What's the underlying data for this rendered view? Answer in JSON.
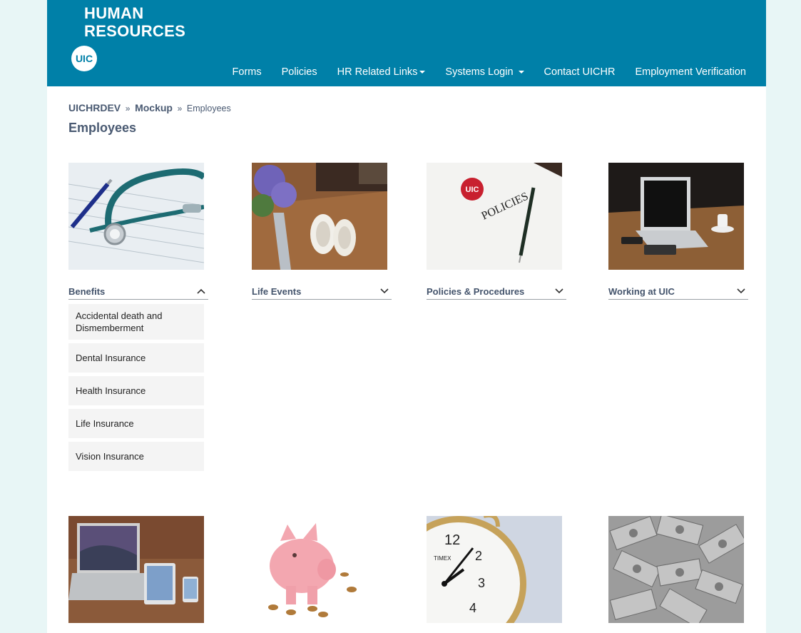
{
  "header": {
    "brand_line1": "HUMAN",
    "brand_line2": "RESOURCES",
    "logo_text": "UIC",
    "nav": [
      {
        "label": "Forms",
        "dropdown": false
      },
      {
        "label": "Policies",
        "dropdown": false
      },
      {
        "label": "HR Related Links",
        "dropdown": true
      },
      {
        "label": "Systems Login",
        "dropdown": true
      },
      {
        "label": "Contact UICHR",
        "dropdown": false
      },
      {
        "label": "Employment Verification",
        "dropdown": false
      }
    ]
  },
  "breadcrumb": {
    "items": [
      "UICHRDEV",
      "Mockup",
      "Employees"
    ],
    "separator": "»"
  },
  "page_title": "Employees",
  "cards": [
    {
      "title": "Benefits",
      "expanded": true,
      "image": "stethoscope-photo",
      "items": [
        "Accidental death and Dismemberment",
        "Dental Insurance",
        "Health Insurance",
        "Life Insurance",
        "Vision Insurance"
      ]
    },
    {
      "title": "Life Events",
      "expanded": false,
      "image": "flowers-shoes-photo"
    },
    {
      "title": "Policies & Procedures",
      "expanded": false,
      "image": "policies-document-photo",
      "image_text": "POLICIES"
    },
    {
      "title": "Working at UIC",
      "expanded": false,
      "image": "laptop-desk-photo"
    },
    {
      "image": "devices-photo"
    },
    {
      "image": "piggy-bank-photo"
    },
    {
      "image": "clock-photo",
      "image_text": "TIMEX"
    },
    {
      "image": "dollar-bills-photo"
    }
  ],
  "colors": {
    "header_bg": "#0080a8",
    "page_bg": "#e8f6f6",
    "heading": "#4a5a72"
  },
  "icons": {
    "expanded": "chevron-up-icon",
    "collapsed": "chevron-down-icon",
    "dropdown": "caret-down-icon"
  }
}
